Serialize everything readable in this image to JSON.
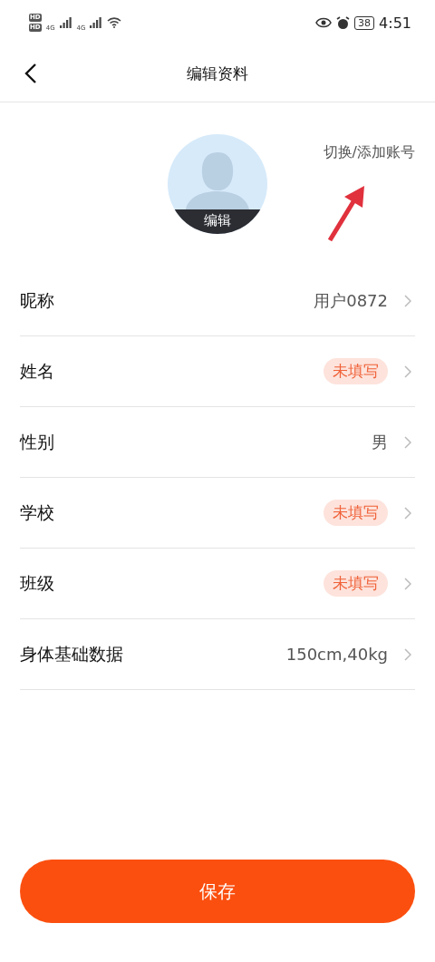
{
  "status_bar": {
    "sim_labels": [
      "HD",
      "HD"
    ],
    "networks": [
      "4G",
      "4G"
    ],
    "battery": "38",
    "time": "4:51"
  },
  "nav": {
    "title": "编辑资料"
  },
  "profile": {
    "avatar_label": "编辑",
    "switch_account": "切换/添加账号",
    "annotation_arrow": true
  },
  "fields": [
    {
      "label": "昵称",
      "value": "用户0872",
      "kind": "value"
    },
    {
      "label": "姓名",
      "value": "未填写",
      "kind": "empty"
    },
    {
      "label": "性别",
      "value": "男",
      "kind": "value"
    },
    {
      "label": "学校",
      "value": "未填写",
      "kind": "empty"
    },
    {
      "label": "班级",
      "value": "未填写",
      "kind": "empty"
    },
    {
      "label": "身体基础数据",
      "value": "150cm,40kg",
      "kind": "value"
    }
  ],
  "save_button": "保存"
}
